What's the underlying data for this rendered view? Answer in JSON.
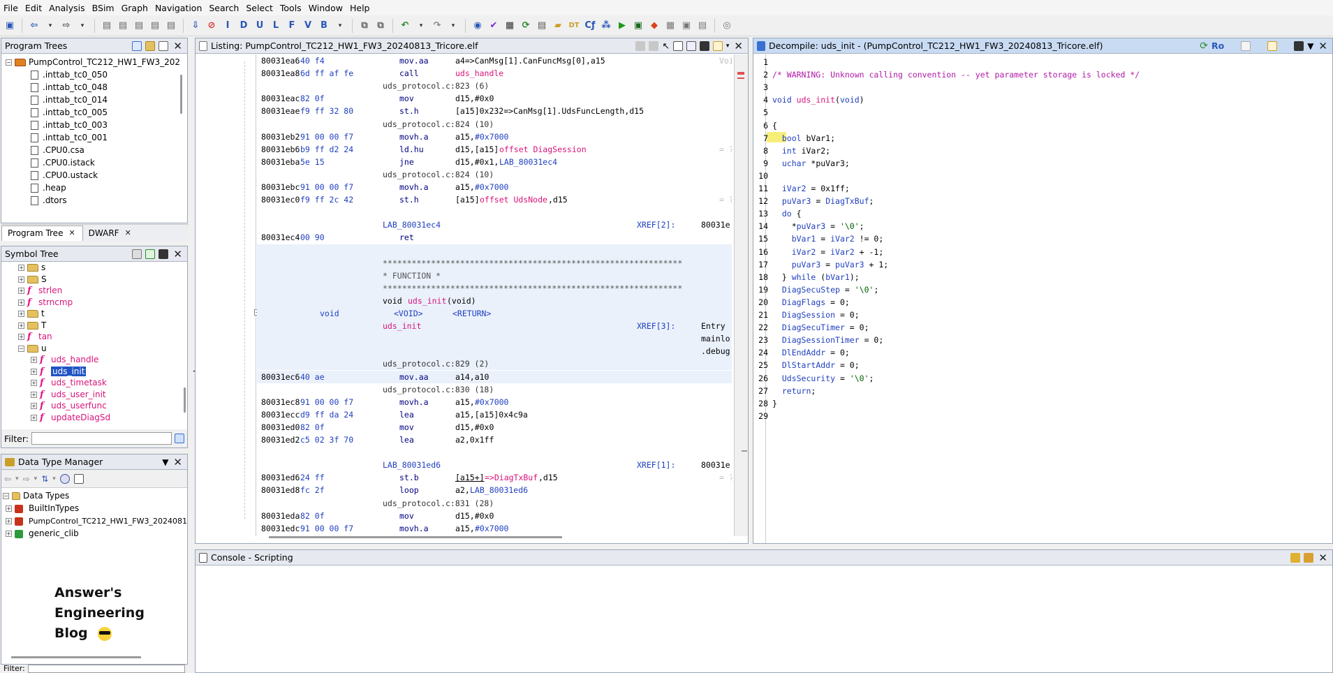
{
  "menu": [
    "File",
    "Edit",
    "Analysis",
    "BSim",
    "Graph",
    "Navigation",
    "Search",
    "Select",
    "Tools",
    "Window",
    "Help"
  ],
  "program_trees": {
    "title": "Program Trees",
    "root": "PumpControl_TC212_HW1_FW3_202",
    "items": [
      ".inttab_tc0_050",
      ".inttab_tc0_048",
      ".inttab_tc0_014",
      ".inttab_tc0_005",
      ".inttab_tc0_003",
      ".inttab_tc0_001",
      ".CPU0.csa",
      ".CPU0.istack",
      ".CPU0.ustack",
      ".heap",
      ".dtors"
    ],
    "tabs": [
      "Program Tree",
      "DWARF"
    ]
  },
  "symbol_tree": {
    "title": "Symbol Tree",
    "rows": [
      {
        "kind": "folder",
        "label": "s",
        "indent": 1
      },
      {
        "kind": "folder",
        "label": "S",
        "indent": 1
      },
      {
        "kind": "func",
        "label": "strlen",
        "indent": 1
      },
      {
        "kind": "func",
        "label": "strncmp",
        "indent": 1
      },
      {
        "kind": "folder",
        "label": "t",
        "indent": 1
      },
      {
        "kind": "folder",
        "label": "T",
        "indent": 1
      },
      {
        "kind": "func",
        "label": "tan",
        "indent": 1
      },
      {
        "kind": "folderopen",
        "label": "u",
        "indent": 1
      },
      {
        "kind": "func",
        "label": "uds_handle",
        "indent": 2
      },
      {
        "kind": "func",
        "label": "uds_init",
        "indent": 2,
        "selected": true
      },
      {
        "kind": "func",
        "label": "uds_timetask",
        "indent": 2
      },
      {
        "kind": "func",
        "label": "uds_user_init",
        "indent": 2
      },
      {
        "kind": "func",
        "label": "uds_userfunc",
        "indent": 2
      },
      {
        "kind": "func",
        "label": "updateDiagSd",
        "indent": 2
      }
    ],
    "filter_label": "Filter:"
  },
  "data_type_manager": {
    "title": "Data Type Manager",
    "root": "Data Types",
    "items": [
      "BuiltInTypes",
      "PumpControl_TC212_HW1_FW3_2024081",
      "generic_clib"
    ]
  },
  "watermark": [
    "Answer's",
    "Engineering",
    "Blog"
  ],
  "bottom_filter_label": "Filter:",
  "listing": {
    "title": "Listing:  PumpControl_TC212_HW1_FW3_20240813_Tricore.elf",
    "rows": [
      {
        "t": "ins",
        "addr": "80031ea6",
        "bytes": "40 f4",
        "mnem": "mov.aa",
        "op": [
          [
            "a4=>CanMsg[1].CanFuncMsg[0],a15",
            "c-op"
          ]
        ],
        "right": "Voi"
      },
      {
        "t": "ins",
        "addr": "80031ea8",
        "bytes": "6d ff af fe",
        "mnem": "call",
        "op": [
          [
            "uds_handle",
            "c-mag"
          ]
        ]
      },
      {
        "t": "src",
        "text": "uds_protocol.c:823 (6)"
      },
      {
        "t": "ins",
        "addr": "80031eac",
        "bytes": "82 0f",
        "mnem": "mov",
        "op": [
          [
            "d15,#0x0",
            "c-op"
          ]
        ]
      },
      {
        "t": "ins",
        "addr": "80031eae",
        "bytes": "f9 ff 32 80",
        "mnem": "st.h",
        "op": [
          [
            "[a15]0x232=>CanMsg[1].UdsFuncLength,d15",
            "c-op"
          ]
        ]
      },
      {
        "t": "src",
        "text": "uds_protocol.c:824 (10)"
      },
      {
        "t": "ins",
        "addr": "80031eb2",
        "bytes": "91 00 00 f7",
        "mnem": "movh.a",
        "op": [
          [
            "a15,",
            "c-op"
          ],
          [
            "#0x7000",
            "c-blue"
          ]
        ]
      },
      {
        "t": "ins",
        "addr": "80031eb6",
        "bytes": "b9 ff d2 24",
        "mnem": "ld.hu",
        "op": [
          [
            "d15,[a15]",
            "c-op"
          ],
          [
            "offset DiagSession",
            "c-mag"
          ]
        ],
        "right": "= ?"
      },
      {
        "t": "ins",
        "addr": "80031eba",
        "bytes": "5e 15",
        "mnem": "jne",
        "op": [
          [
            "d15,#0x1,",
            "c-op"
          ],
          [
            "LAB_80031ec4",
            "c-blue"
          ]
        ]
      },
      {
        "t": "src",
        "text": "uds_protocol.c:824 (10)"
      },
      {
        "t": "ins",
        "addr": "80031ebc",
        "bytes": "91 00 00 f7",
        "mnem": "movh.a",
        "op": [
          [
            "a15,",
            "c-op"
          ],
          [
            "#0x7000",
            "c-blue"
          ]
        ]
      },
      {
        "t": "ins",
        "addr": "80031ec0",
        "bytes": "f9 ff 2c 42",
        "mnem": "st.h",
        "op": [
          [
            "[a15]",
            "c-op"
          ],
          [
            "offset UdsNode",
            "c-mag"
          ],
          [
            ",d15",
            "c-op"
          ]
        ],
        "right": "= ?"
      },
      {
        "t": "blank"
      },
      {
        "t": "label",
        "text": "LAB_80031ec4",
        "xref": "XREF[2]:",
        "xrefaddr": "80031e"
      },
      {
        "t": "ins",
        "addr": "80031ec4",
        "bytes": "00 90",
        "mnem": "ret",
        "op": []
      },
      {
        "t": "blank"
      },
      {
        "t": "star",
        "text": "**************************************************************"
      },
      {
        "t": "starmid",
        "text": "*                          FUNCTION                          *"
      },
      {
        "t": "star",
        "text": "**************************************************************"
      },
      {
        "t": "sig",
        "ret": "void",
        "name": "uds_init",
        "args": "(void)"
      },
      {
        "t": "retinfo",
        "type": "void",
        "a": "<VOID>",
        "b": "<RETURN>"
      },
      {
        "t": "fnlabel",
        "text": "uds_init",
        "xref": "XREF[3]:",
        "xrefaddr": "Entry"
      },
      {
        "t": "xrefonly",
        "text": "mainlo"
      },
      {
        "t": "xrefonly",
        "text": ".debug"
      },
      {
        "t": "src",
        "text": "uds_protocol.c:829 (2)"
      },
      {
        "t": "ins",
        "addr": "80031ec6",
        "bytes": "40 ae",
        "mnem": "mov.aa",
        "op": [
          [
            "a14,a10",
            "c-op"
          ]
        ]
      },
      {
        "t": "src",
        "text": "uds_protocol.c:830 (18)"
      },
      {
        "t": "ins",
        "addr": "80031ec8",
        "bytes": "91 00 00 f7",
        "mnem": "movh.a",
        "op": [
          [
            "a15,",
            "c-op"
          ],
          [
            "#0x7000",
            "c-blue"
          ]
        ]
      },
      {
        "t": "ins",
        "addr": "80031ecc",
        "bytes": "d9 ff da 24",
        "mnem": "lea",
        "op": [
          [
            "a15,[a15]0x4c9a",
            "c-op"
          ]
        ]
      },
      {
        "t": "ins",
        "addr": "80031ed0",
        "bytes": "82 0f",
        "mnem": "mov",
        "op": [
          [
            "d15,#0x0",
            "c-op"
          ]
        ]
      },
      {
        "t": "ins",
        "addr": "80031ed2",
        "bytes": "c5 02 3f 70",
        "mnem": "lea",
        "op": [
          [
            "a2,0x1ff",
            "c-op"
          ]
        ]
      },
      {
        "t": "blank"
      },
      {
        "t": "label",
        "text": "LAB_80031ed6",
        "xref": "XREF[1]:",
        "xrefaddr": "80031e"
      },
      {
        "t": "ins",
        "addr": "80031ed6",
        "bytes": "24 ff",
        "mnem": "st.b",
        "op": [
          [
            "[a15+]",
            "c-op"
          ],
          [
            "=>DiagTxBuf",
            "c-mag"
          ],
          [
            ",d15",
            "c-op"
          ]
        ],
        "right": "= ?",
        "underline": true
      },
      {
        "t": "ins",
        "addr": "80031ed8",
        "bytes": "fc 2f",
        "mnem": "loop",
        "op": [
          [
            "a2,",
            "c-op"
          ],
          [
            "LAB_80031ed6",
            "c-blue"
          ]
        ]
      },
      {
        "t": "src",
        "text": "uds_protocol.c:831 (28)"
      },
      {
        "t": "ins",
        "addr": "80031eda",
        "bytes": "82 0f",
        "mnem": "mov",
        "op": [
          [
            "d15,#0x0",
            "c-op"
          ]
        ]
      },
      {
        "t": "ins",
        "addr": "80031edc",
        "bytes": "91 00 00 f7",
        "mnem": "movh.a",
        "op": [
          [
            "a15,",
            "c-op"
          ],
          [
            "#0x7000",
            "c-blue"
          ]
        ]
      }
    ]
  },
  "decompile": {
    "title": "Decompile: uds_init -  (PumpControl_TC212_HW1_FW3_20240813_Tricore.elf)",
    "head_ro": "Ro",
    "lines": [
      [],
      [
        [
          "/* WARNING: Unknown calling convention -- yet parameter storage is locked */",
          "k-cmt"
        ]
      ],
      [],
      [
        [
          "void",
          "k-type"
        ],
        [
          " ",
          ""
        ],
        [
          "uds_init",
          "k-fn"
        ],
        [
          "(",
          ""
        ],
        [
          "void",
          "k-type"
        ],
        [
          ")",
          ""
        ]
      ],
      [],
      [
        [
          "{",
          ""
        ]
      ],
      [
        [
          "  ",
          ""
        ],
        [
          "bool",
          "k-type"
        ],
        [
          " bVar1;",
          ""
        ]
      ],
      [
        [
          "  ",
          ""
        ],
        [
          "int",
          "k-type"
        ],
        [
          " iVar2;",
          ""
        ]
      ],
      [
        [
          "  ",
          ""
        ],
        [
          "uchar",
          "k-type"
        ],
        [
          " *puVar3;",
          ""
        ]
      ],
      [],
      [
        [
          "  ",
          ""
        ],
        [
          "iVar2",
          "k-var"
        ],
        [
          " = 0x1ff;",
          ""
        ]
      ],
      [
        [
          "  ",
          ""
        ],
        [
          "puVar3",
          "k-var"
        ],
        [
          " = ",
          ""
        ],
        [
          "DiagTxBuf",
          "k-glob"
        ],
        [
          ";",
          ""
        ]
      ],
      [
        [
          "  ",
          ""
        ],
        [
          "do",
          "k-key"
        ],
        [
          " {",
          ""
        ]
      ],
      [
        [
          "    *",
          ""
        ],
        [
          "puVar3",
          "k-var"
        ],
        [
          " = ",
          ""
        ],
        [
          "'\\0'",
          "k-str"
        ],
        [
          ";",
          ""
        ]
      ],
      [
        [
          "    ",
          ""
        ],
        [
          "bVar1",
          "k-var"
        ],
        [
          " = ",
          ""
        ],
        [
          "iVar2",
          "k-var"
        ],
        [
          " != 0;",
          ""
        ]
      ],
      [
        [
          "    ",
          ""
        ],
        [
          "iVar2",
          "k-var"
        ],
        [
          " = ",
          ""
        ],
        [
          "iVar2",
          "k-var"
        ],
        [
          " + -1;",
          ""
        ]
      ],
      [
        [
          "    ",
          ""
        ],
        [
          "puVar3",
          "k-var"
        ],
        [
          " = ",
          ""
        ],
        [
          "puVar3",
          "k-var"
        ],
        [
          " + 1;",
          ""
        ]
      ],
      [
        [
          "  } ",
          ""
        ],
        [
          "while",
          "k-key"
        ],
        [
          " (",
          ""
        ],
        [
          "bVar1",
          "k-var"
        ],
        [
          ");",
          ""
        ]
      ],
      [
        [
          "  ",
          ""
        ],
        [
          "DiagSecuStep",
          "k-glob"
        ],
        [
          " = ",
          ""
        ],
        [
          "'\\0'",
          "k-str"
        ],
        [
          ";",
          ""
        ]
      ],
      [
        [
          "  ",
          ""
        ],
        [
          "DiagFlags",
          "k-glob"
        ],
        [
          " = 0;",
          ""
        ]
      ],
      [
        [
          "  ",
          ""
        ],
        [
          "DiagSession",
          "k-glob"
        ],
        [
          " = 0;",
          ""
        ]
      ],
      [
        [
          "  ",
          ""
        ],
        [
          "DiagSecuTimer",
          "k-glob"
        ],
        [
          " = 0;",
          ""
        ]
      ],
      [
        [
          "  ",
          ""
        ],
        [
          "DiagSessionTimer",
          "k-glob"
        ],
        [
          " = 0;",
          ""
        ]
      ],
      [
        [
          "  ",
          ""
        ],
        [
          "DlEndAddr",
          "k-glob"
        ],
        [
          " = 0;",
          ""
        ]
      ],
      [
        [
          "  ",
          ""
        ],
        [
          "DlStartAddr",
          "k-glob"
        ],
        [
          " = 0;",
          ""
        ]
      ],
      [
        [
          "  ",
          ""
        ],
        [
          "UdsSecurity",
          "k-glob"
        ],
        [
          " = ",
          ""
        ],
        [
          "'\\0'",
          "k-str"
        ],
        [
          ";",
          ""
        ]
      ],
      [
        [
          "  ",
          ""
        ],
        [
          "return",
          "k-key"
        ],
        [
          ";",
          ""
        ]
      ],
      [
        [
          "}",
          ""
        ]
      ],
      []
    ]
  },
  "console": {
    "title": "Console - Scripting"
  },
  "colors": {
    "accent": "#2255c4",
    "panel_head": "#e6e9ef",
    "active_head": "#c9dbf3",
    "listing_highlight": "#eaf1fb"
  }
}
